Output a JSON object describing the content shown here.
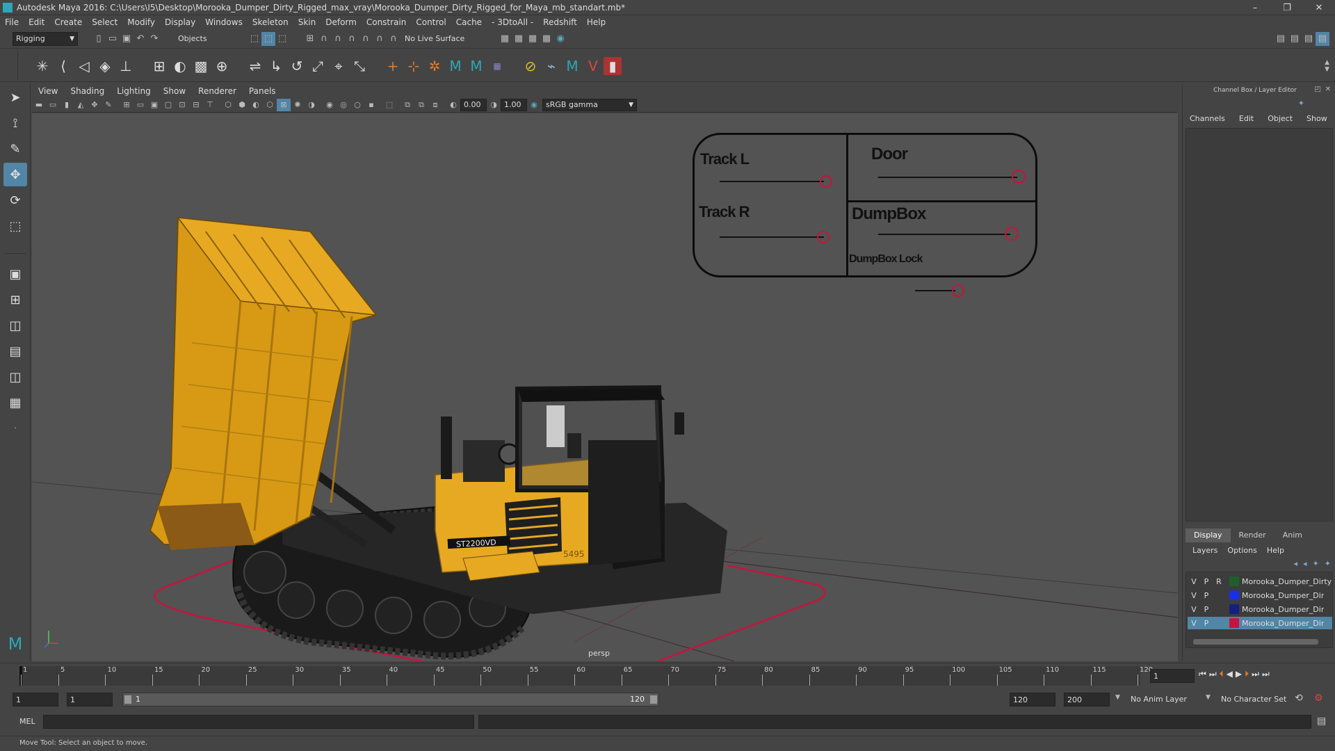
{
  "app": {
    "title": "Autodesk Maya 2016: C:\\Users\\I5\\Desktop\\Morooka_Dumper_Dirty_Rigged_max_vray\\Morooka_Dumper_Dirty_Rigged_for_Maya_mb_standart.mb*",
    "minimize": "–",
    "restore": "❐",
    "close": "✕"
  },
  "menu": [
    "File",
    "Edit",
    "Create",
    "Select",
    "Modify",
    "Display",
    "Windows",
    "Skeleton",
    "Skin",
    "Deform",
    "Constrain",
    "Control",
    "Cache",
    "- 3DtoAll -",
    "Redshift",
    "Help"
  ],
  "statusline": {
    "mode": "Rigging",
    "select_mode": "Objects",
    "live_surface": "No Live Surface"
  },
  "viewport": {
    "menu": [
      "View",
      "Shading",
      "Lighting",
      "Show",
      "Renderer",
      "Panels"
    ],
    "exposure": "0.00",
    "gamma": "1.00",
    "colorspace": "sRGB gamma",
    "camera": "persp",
    "vehicle_model": "ST2200VD",
    "vehicle_number": "5495"
  },
  "rig_panel": {
    "track_l": "Track L",
    "track_r": "Track R",
    "door": "Door",
    "dumpbox": "DumpBox",
    "dumpbox_lock": "DumpBox Lock",
    "accent": "#c8143c"
  },
  "channel_box": {
    "title": "Channel Box / Layer Editor",
    "menu": [
      "Channels",
      "Edit",
      "Object",
      "Show"
    ]
  },
  "layer_editor": {
    "tabs": [
      "Display",
      "Render",
      "Anim"
    ],
    "menu": [
      "Layers",
      "Options",
      "Help"
    ],
    "layers": [
      {
        "v": "V",
        "p": "P",
        "r": "R",
        "color": "#1f5e2b",
        "name": "Morooka_Dumper_Dirty"
      },
      {
        "v": "V",
        "p": "P",
        "r": "",
        "color": "#1a2ee6",
        "name": "Morooka_Dumper_Dir"
      },
      {
        "v": "V",
        "p": "P",
        "r": "",
        "color": "#142080",
        "name": "Morooka_Dumper_Dir"
      },
      {
        "v": "V",
        "p": "P",
        "r": "",
        "color": "#c8143c",
        "name": "Morooka_Dumper_Dir"
      }
    ]
  },
  "timeline": {
    "ticks": [
      "1",
      "5",
      "10",
      "15",
      "20",
      "25",
      "30",
      "35",
      "40",
      "45",
      "50",
      "55",
      "60",
      "65",
      "70",
      "75",
      "80",
      "85",
      "90",
      "95",
      "100",
      "105",
      "110",
      "115",
      "120"
    ],
    "current_frame": "1"
  },
  "range": {
    "start": "1",
    "playback_start": "1",
    "slider_start": "1",
    "slider_end": "120",
    "playback_end": "120",
    "end": "200",
    "anim_layer": "No Anim Layer",
    "character_set": "No Character Set"
  },
  "cmdline": {
    "label": "MEL"
  },
  "help": {
    "text": "Move Tool: Select an object to move."
  }
}
